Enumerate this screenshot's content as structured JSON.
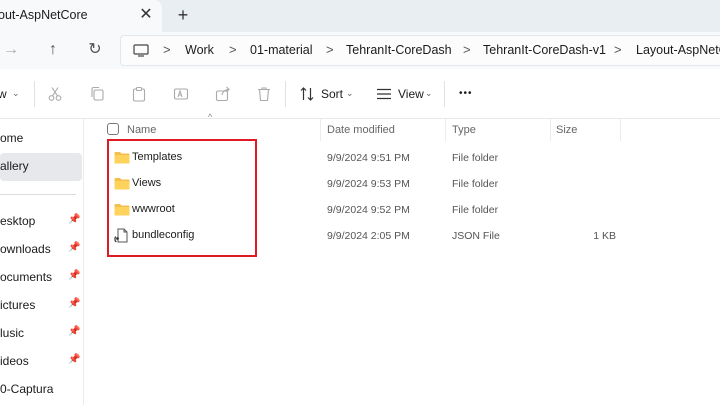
{
  "window": {
    "tab_title": "out-AspNetCore",
    "close_glyph": "✕",
    "new_tab_glyph": "+"
  },
  "nav": {
    "forward_glyph": "→",
    "up_glyph": "↑",
    "refresh_glyph": "↻",
    "breadcrumbs": [
      "Work",
      "01-material",
      "TehranIt-CoreDash",
      "TehranIt-CoreDash-v1",
      "Layout-AspNetCore"
    ],
    "separator": ">"
  },
  "toolbar": {
    "new_label": "w",
    "sort_label": "Sort",
    "view_label": "View",
    "more_label": "•••",
    "chevron": "⌄"
  },
  "sidebar": {
    "items": [
      {
        "label": "ome",
        "pinned": false
      },
      {
        "label": "allery",
        "pinned": false,
        "selected": true
      },
      {
        "label": "esktop",
        "pinned": true
      },
      {
        "label": "ownloads",
        "pinned": true
      },
      {
        "label": "ocuments",
        "pinned": true
      },
      {
        "label": "ictures",
        "pinned": true
      },
      {
        "label": "lusic",
        "pinned": true
      },
      {
        "label": "ideos",
        "pinned": true
      },
      {
        "label": "0-Captura",
        "pinned": false
      }
    ],
    "pin_glyph": "📌"
  },
  "columns": {
    "name": "Name",
    "date_modified": "Date modified",
    "type": "Type",
    "size": "Size",
    "sort_glyph": "^"
  },
  "files": [
    {
      "name": "Templates",
      "date": "9/9/2024 9:51 PM",
      "type": "File folder",
      "size": "",
      "icon": "folder-icon"
    },
    {
      "name": "Views",
      "date": "9/9/2024 9:53 PM",
      "type": "File folder",
      "size": "",
      "icon": "folder-icon"
    },
    {
      "name": "wwwroot",
      "date": "9/9/2024 9:52 PM",
      "type": "File folder",
      "size": "",
      "icon": "folder-icon"
    },
    {
      "name": "bundleconfig",
      "date": "9/9/2024 2:05 PM",
      "type": "JSON File",
      "size": "1 KB",
      "icon": "json-file-icon"
    }
  ],
  "colors": {
    "folder": "#f4c04d",
    "highlight": "#e01b24",
    "tabbar": "#e9eef3",
    "selected_bg": "#e6e8eb"
  }
}
